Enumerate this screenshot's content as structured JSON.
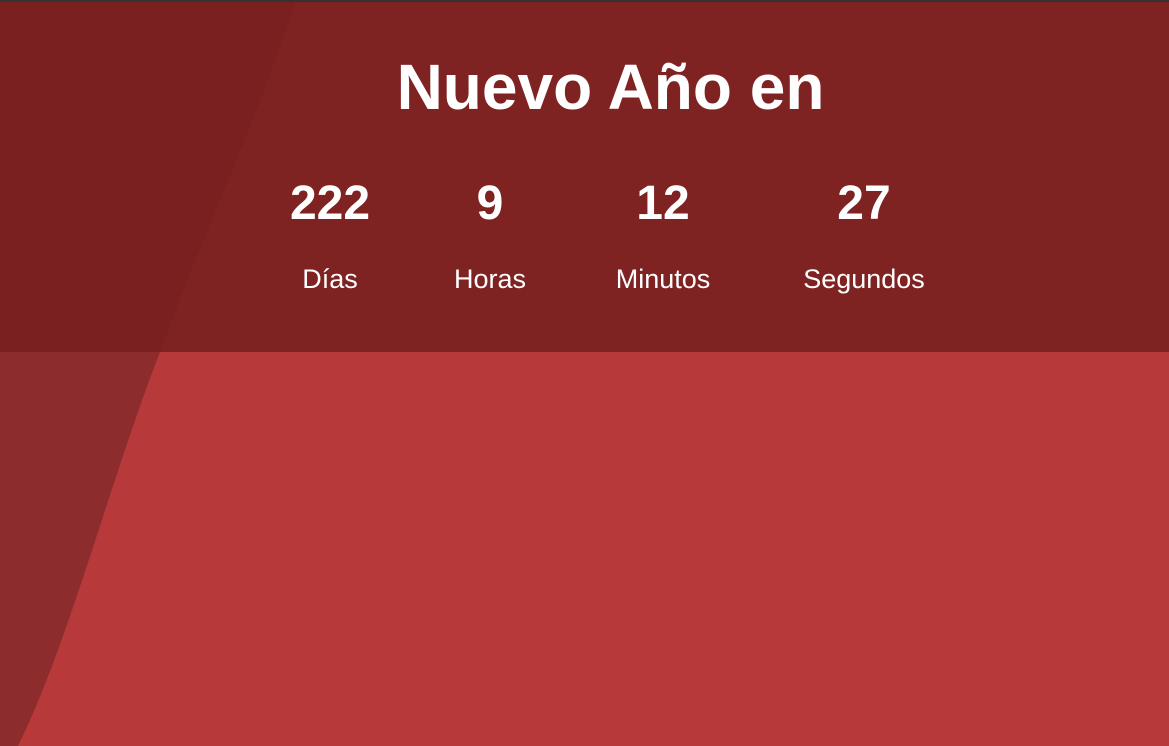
{
  "title": "Nuevo Año en",
  "countdown": [
    {
      "value": "222",
      "label": "Días"
    },
    {
      "value": "9",
      "label": "Horas"
    },
    {
      "value": "12",
      "label": "Minutos"
    },
    {
      "value": "27",
      "label": "Segundos"
    }
  ],
  "colors": {
    "background": "#b73939",
    "header": "#7f2222",
    "curve_top": "#7a2020",
    "curve_bottom": "#8c2c2c"
  }
}
